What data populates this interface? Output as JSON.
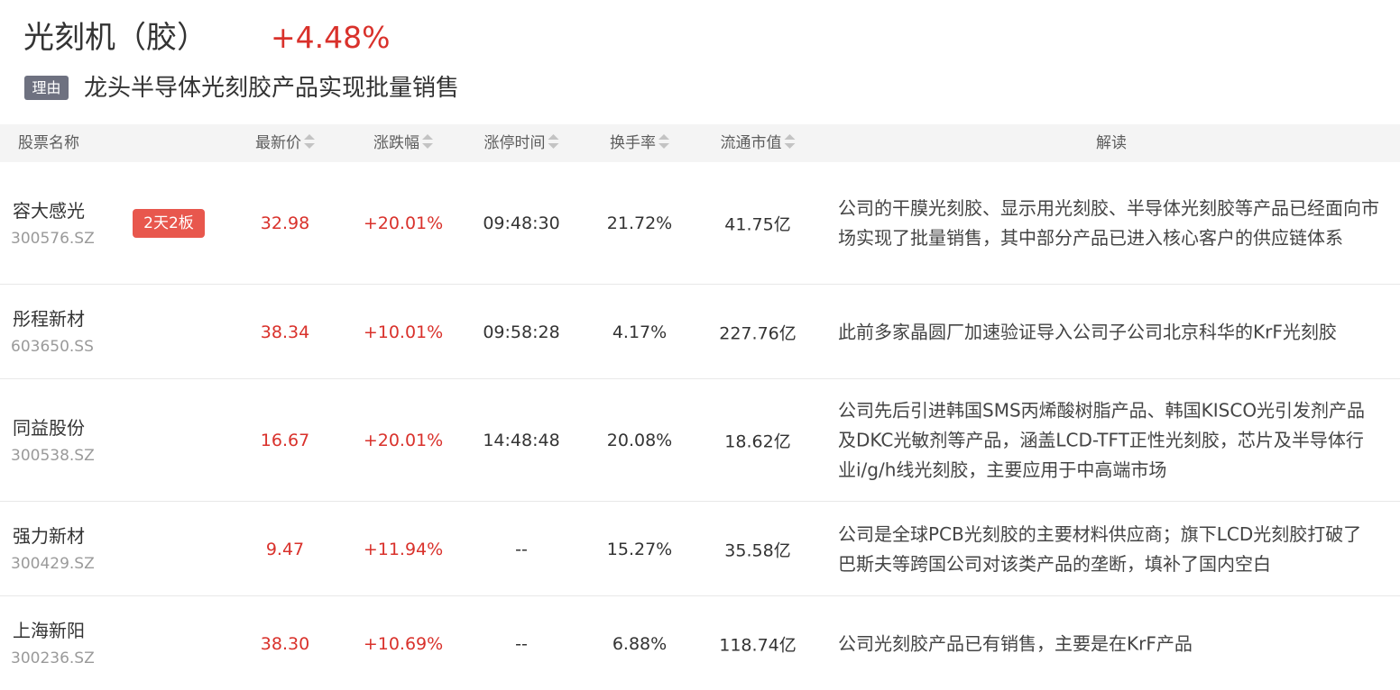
{
  "header": {
    "title": "光刻机（胶）",
    "change": "+4.48%",
    "reason_tag": "理由",
    "reason_text": "龙头半导体光刻胶产品实现批量销售"
  },
  "table": {
    "columns": {
      "name": "股票名称",
      "price": "最新价",
      "change": "涨跌幅",
      "limit_time": "涨停时间",
      "turnover": "换手率",
      "market_cap": "流通市值",
      "interpretation": "解读"
    },
    "rows": [
      {
        "name": "容大感光",
        "code": "300576.SZ",
        "badge": "2天2板",
        "price": "32.98",
        "change": "+20.01%",
        "limit_time": "09:48:30",
        "turnover": "21.72%",
        "market_cap": "41.75亿",
        "interpretation": "公司的干膜光刻胶、显示用光刻胶、半导体光刻胶等产品已经面向市场实现了批量销售，其中部分产品已进入核心客户的供应链体系"
      },
      {
        "name": "彤程新材",
        "code": "603650.SS",
        "badge": "",
        "price": "38.34",
        "change": "+10.01%",
        "limit_time": "09:58:28",
        "turnover": "4.17%",
        "market_cap": "227.76亿",
        "interpretation": "此前多家晶圆厂加速验证导入公司子公司北京科华的KrF光刻胶"
      },
      {
        "name": "同益股份",
        "code": "300538.SZ",
        "badge": "",
        "price": "16.67",
        "change": "+20.01%",
        "limit_time": "14:48:48",
        "turnover": "20.08%",
        "market_cap": "18.62亿",
        "interpretation": "公司先后引进韩国SMS丙烯酸树脂产品、韩国KISCO光引发剂产品及DKC光敏剂等产品，涵盖LCD-TFT正性光刻胶，芯片及半导体行业i/g/h线光刻胶，主要应用于中高端市场"
      },
      {
        "name": "强力新材",
        "code": "300429.SZ",
        "badge": "",
        "price": "9.47",
        "change": "+11.94%",
        "limit_time": "--",
        "turnover": "15.27%",
        "market_cap": "35.58亿",
        "interpretation": "公司是全球PCB光刻胶的主要材料供应商；旗下LCD光刻胶打破了巴斯夫等跨国公司对该类产品的垄断，填补了国内空白"
      },
      {
        "name": "上海新阳",
        "code": "300236.SZ",
        "badge": "",
        "price": "38.30",
        "change": "+10.69%",
        "limit_time": "--",
        "turnover": "6.88%",
        "market_cap": "118.74亿",
        "interpretation": "公司光刻胶产品已有销售，主要是在KrF产品"
      }
    ]
  },
  "colors": {
    "up_red": "#d9312b",
    "badge_red": "#e8574d",
    "tag_gray": "#6e7180",
    "header_bg": "#f4f4f4"
  },
  "icons": {
    "sort": "sort-arrows-icon"
  }
}
